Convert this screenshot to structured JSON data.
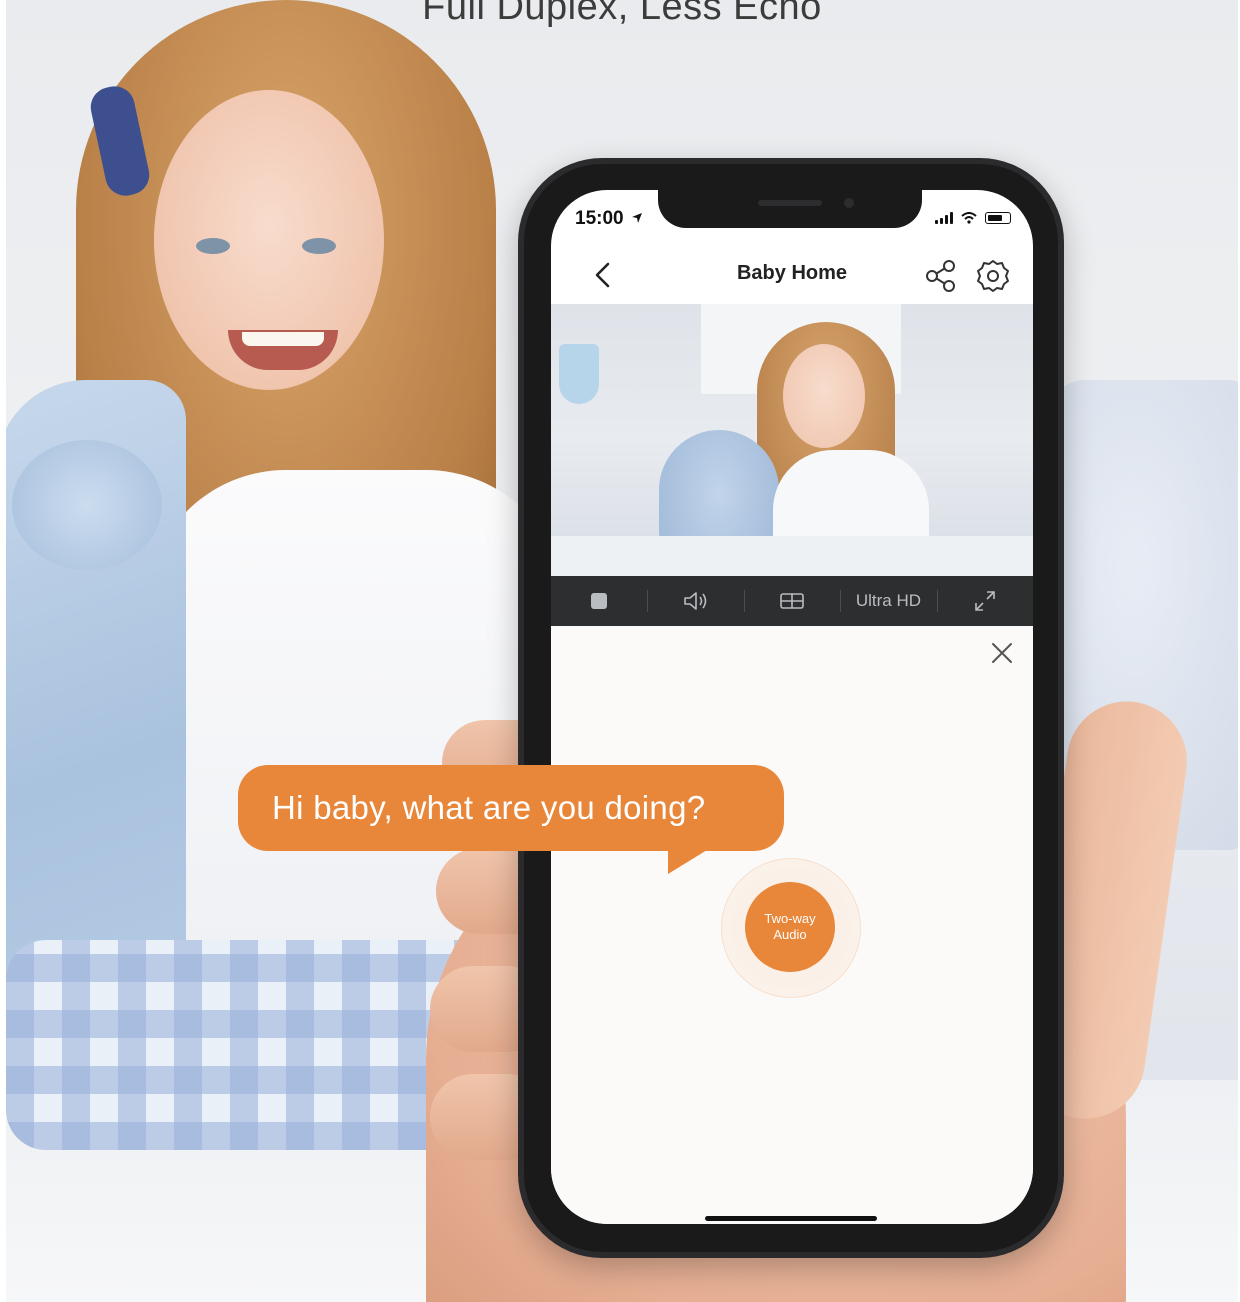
{
  "headline": "Full Duplex, Less Echo",
  "phone": {
    "status_bar": {
      "time": "15:00"
    },
    "header": {
      "title": "Baby Home"
    },
    "toolbar": {
      "quality_label": "Ultra HD"
    },
    "two_way_audio": {
      "line1": "Two-way",
      "line2": "Audio"
    }
  },
  "speech_bubble": {
    "text": "Hi baby, what are you doing?"
  },
  "colors": {
    "accent_orange": "#e8863a",
    "toolbar_dark": "#2d2e30"
  },
  "icons": [
    "back-arrow-icon",
    "share-icon",
    "gear-icon",
    "stop-icon",
    "speaker-icon",
    "split-view-icon",
    "fullscreen-icon",
    "close-icon",
    "location-arrow-icon",
    "signal-icon",
    "wifi-icon",
    "battery-icon"
  ]
}
